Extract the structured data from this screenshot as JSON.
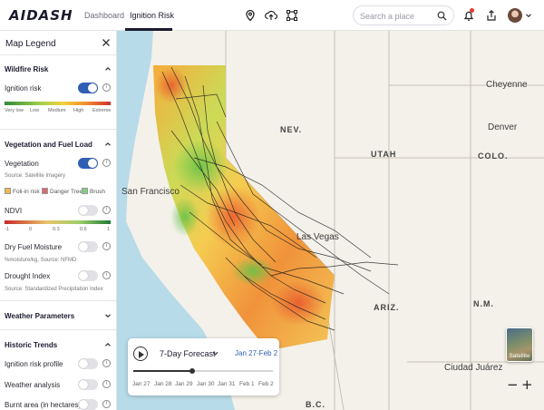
{
  "app": {
    "logo": "AIDASH"
  },
  "nav": {
    "tabs": [
      {
        "label": "Dashboard"
      },
      {
        "label": "Ignition Risk"
      }
    ]
  },
  "search": {
    "placeholder": "Search a place"
  },
  "legend": {
    "title": "Map Legend",
    "wildfire": {
      "heading": "Wildfire Risk",
      "ignition_label": "Ignition risk",
      "ignition_on": true,
      "scale": [
        "Very low",
        "Low",
        "Medium",
        "High",
        "Extreme"
      ]
    },
    "vegetation": {
      "heading": "Vegetation and Fuel Load",
      "vegetation_label": "Vegetation",
      "vegetation_on": true,
      "vegetation_source": "Source: Satellite Imagery",
      "chips": [
        {
          "label": "Foli-in risk",
          "color": "#f2b84b"
        },
        {
          "label": "Danger Tree",
          "color": "#d96b6b"
        },
        {
          "label": "Brush",
          "color": "#7ed07e"
        }
      ],
      "ndvi_label": "NDVI",
      "ndvi_scale": [
        "-1",
        "0",
        "0.3",
        "0.6",
        "1"
      ],
      "dfm_label": "Dry Fuel Moisture",
      "dfm_source": "%moisture/kg, Source: NFMD",
      "drought_label": "Drought Index",
      "drought_source": "Source: Standardized Precipitation Index"
    },
    "weather": {
      "heading": "Weather Parameters"
    },
    "historic": {
      "heading": "Historic Trends",
      "items": [
        {
          "label": "Ignition risk profile"
        },
        {
          "label": "Weather analysis"
        },
        {
          "label": "Burnt area (in hectares)"
        }
      ]
    }
  },
  "map": {
    "labels": {
      "san_francisco": "San Francisco",
      "las_vegas": "Las Vegas",
      "cheyenne": "Cheyenne",
      "denver": "Denver",
      "ciudad_juarez": "Ciudad Juárez",
      "nev": "NEV.",
      "utah": "UTAH",
      "colo": "COLO.",
      "ariz": "ARIZ.",
      "nm": "N.M.",
      "bc": "B.C."
    },
    "satellite_label": "Satellite"
  },
  "forecast": {
    "title": "7-Day Forecast",
    "range": "Jan 27-Feb 2",
    "progress": 0.42,
    "days": [
      "Jan 27",
      "Jan 28",
      "Jan 29",
      "Jan 30",
      "Jan 31",
      "Feb 1",
      "Feb 2"
    ]
  },
  "zoom": {
    "out": "−",
    "in": "+"
  }
}
